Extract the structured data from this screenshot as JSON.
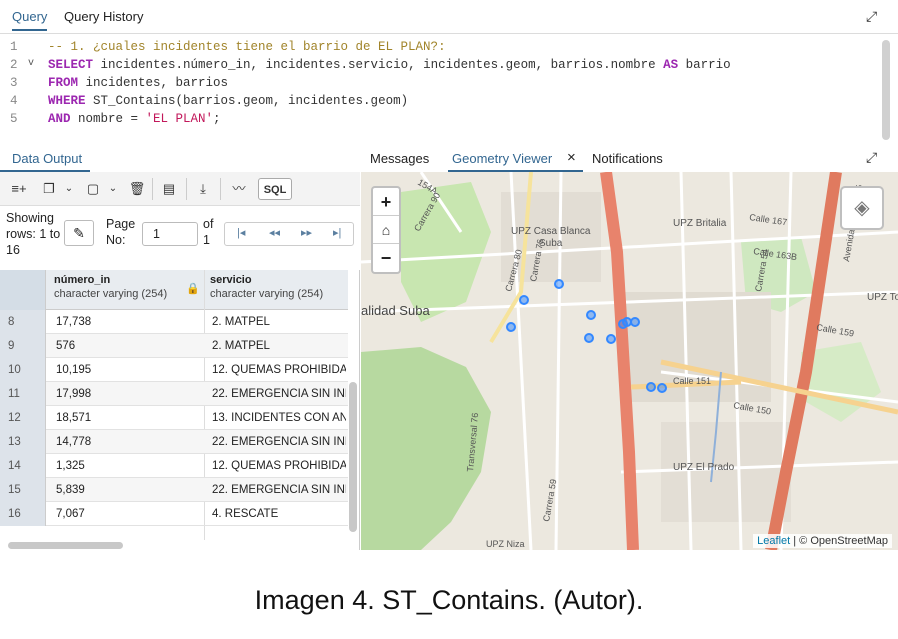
{
  "top_tabs": [
    "Query",
    "Query History"
  ],
  "editor": {
    "lines": [
      {
        "num": "1",
        "parts": [
          [
            "cm",
            "-- 1. ¿cuales incidentes tiene el barrio de EL PLAN?:"
          ]
        ]
      },
      {
        "num": "2",
        "fold": "v",
        "parts": [
          [
            "kw",
            "SELECT"
          ],
          [
            "",
            " incidentes.número_in, incidentes.servicio, incidentes.geom, barrios.nombre "
          ],
          [
            "kw",
            "AS"
          ],
          [
            "",
            " barrio"
          ]
        ]
      },
      {
        "num": "3",
        "parts": [
          [
            "kw",
            "FROM"
          ],
          [
            "",
            " incidentes, barrios"
          ]
        ]
      },
      {
        "num": "4",
        "parts": [
          [
            "kw",
            "WHERE"
          ],
          [
            "",
            " ST_Contains(barrios.geom, incidentes.geom)"
          ]
        ]
      },
      {
        "num": "5",
        "parts": [
          [
            "kw",
            "AND"
          ],
          [
            "",
            " nombre = "
          ],
          [
            "st",
            "'EL PLAN'"
          ],
          [
            "",
            ";"
          ]
        ]
      }
    ]
  },
  "lower_tabs": {
    "data_output": "Data Output",
    "messages": "Messages",
    "geometry_viewer": "Geometry Viewer",
    "close": "×",
    "notifications": "Notifications"
  },
  "toolbar": {
    "sql_label": "SQL"
  },
  "pager": {
    "showing": "Showing rows: 1 to 16",
    "page_label": "Page No:",
    "page_value": "1",
    "of_label": "of 1"
  },
  "grid": {
    "columns": [
      {
        "name": "número_in",
        "type": "character varying (254)"
      },
      {
        "name": "servicio",
        "type": "character varying (254)"
      }
    ],
    "rows": [
      {
        "n": "8",
        "c1": "17,738",
        "c2": "2. MATPEL"
      },
      {
        "n": "9",
        "c1": "576",
        "c2": "2. MATPEL"
      },
      {
        "n": "10",
        "c1": "10,195",
        "c2": "12. QUEMAS PROHIBIDAS"
      },
      {
        "n": "11",
        "c1": "17,998",
        "c2": "22. EMERGENCIA SIN INFO"
      },
      {
        "n": "12",
        "c1": "18,571",
        "c2": "13. INCIDENTES CON AN"
      },
      {
        "n": "13",
        "c1": "14,778",
        "c2": "22. EMERGENCIA SIN INFO"
      },
      {
        "n": "14",
        "c1": "1,325",
        "c2": "12. QUEMAS PROHIBIDAS"
      },
      {
        "n": "15",
        "c1": "5,839",
        "c2": "22. EMERGENCIA SIN INFO"
      },
      {
        "n": "16",
        "c1": "7,067",
        "c2": "4. RESCATE"
      }
    ]
  },
  "map": {
    "labels": {
      "upz_casa_blanca": "UPZ Casa Blanca",
      "suba": "Suba",
      "upz_britalia": "UPZ Britalia",
      "calle_167": "Calle 167",
      "calle_163b": "Calle 163B",
      "calle_159": "Calle 159",
      "calle_151": "Calle 151",
      "calle_150": "Calle 150",
      "upz_el_prado": "UPZ El Prado",
      "upz_to": "UPZ To",
      "alidad_suba": "alidad Suba",
      "carrera_90": "Carrera 90",
      "carrera_80": "Carrera 80",
      "carrera_76": "Carrera 76",
      "transversal_76": "Transversal 76",
      "carrera_59": "Carrera 59",
      "carrera_54": "Carrera 54",
      "carrera_45": "Avenida Carrera 45",
      "upz_niza": "UPZ Niza",
      "calle_154a": "154A"
    },
    "attribution_leaflet": "Leaflet",
    "attribution_osm": "| © OpenStreetMap",
    "point_color": "#3388ff"
  },
  "caption": "Imagen 4. ST_Contains. (Autor)."
}
